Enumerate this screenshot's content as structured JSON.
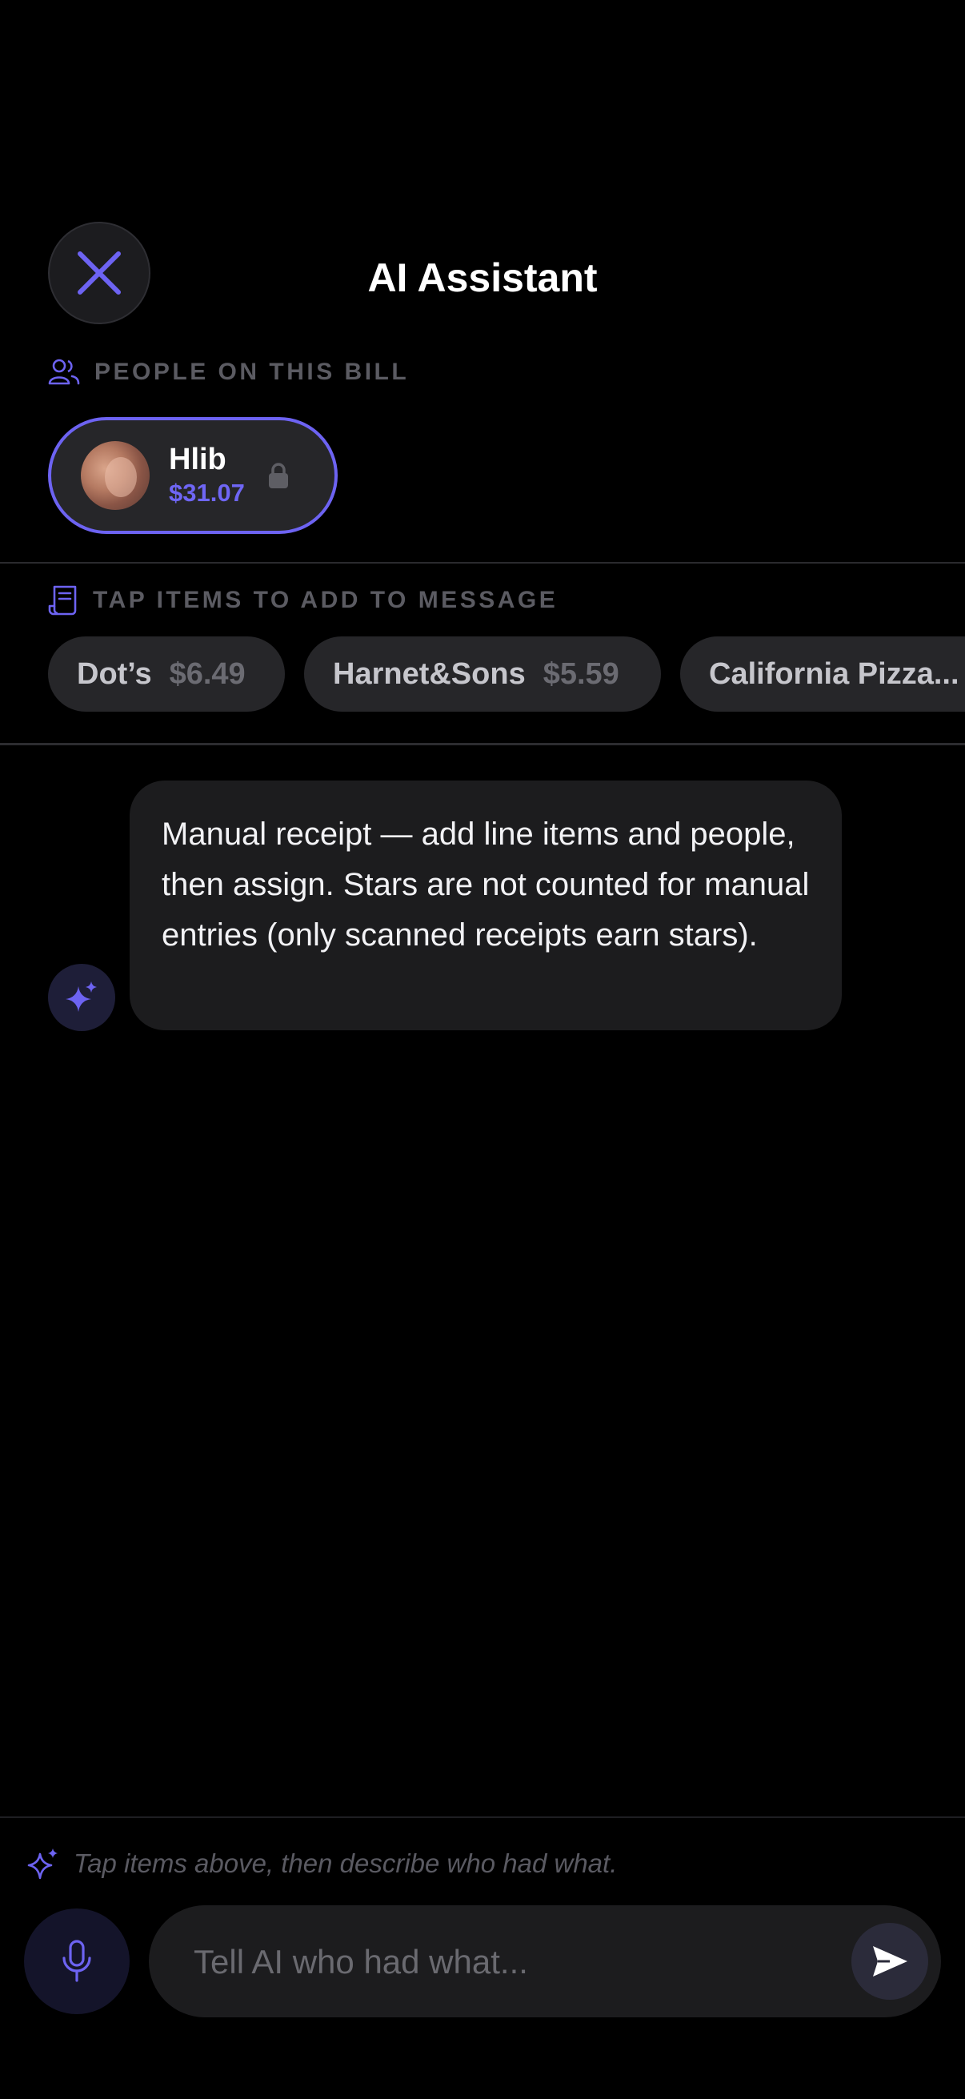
{
  "header": {
    "title": "AI Assistant"
  },
  "people_section": {
    "heading": "PEOPLE ON THIS BILL",
    "people": [
      {
        "name": "Hlib",
        "amount": "$31.07",
        "locked": true
      }
    ]
  },
  "items_section": {
    "heading": "TAP ITEMS TO ADD TO MESSAGE",
    "items": [
      {
        "name": "Dot’s",
        "price": "$6.49"
      },
      {
        "name": "Harnet&Sons",
        "price": "$5.59"
      },
      {
        "name": "California Pizza..."
      }
    ]
  },
  "chat": {
    "messages": [
      {
        "from": "ai",
        "text": "Manual receipt — add line items and people, then assign. Stars are not counted for manual entries (only scanned receipts earn stars)."
      }
    ]
  },
  "composer": {
    "hint": "Tap items above, then describe who had what.",
    "placeholder": "Tell AI who had what..."
  },
  "colors": {
    "accent": "#6d63f2",
    "background": "#000000",
    "chip": "#262629",
    "bubble": "#1c1c1e"
  },
  "icons": [
    "close-icon",
    "people-icon",
    "lock-icon",
    "receipt-icon",
    "sparkle-icon",
    "mic-icon",
    "send-icon"
  ]
}
